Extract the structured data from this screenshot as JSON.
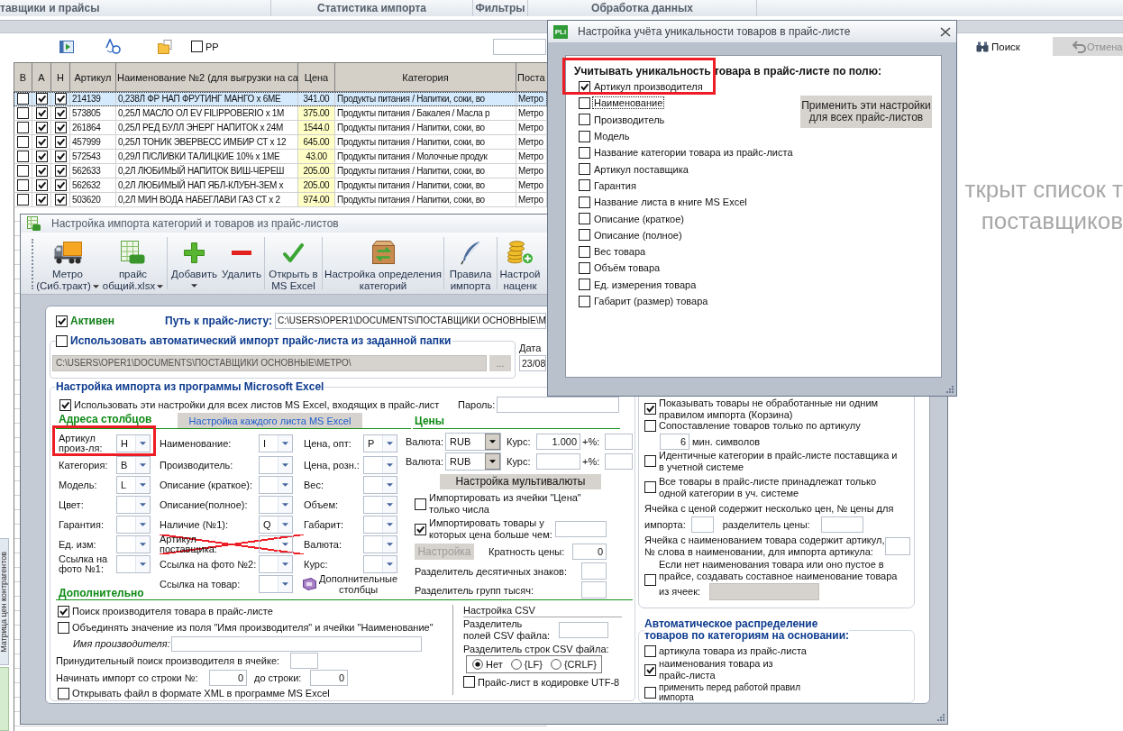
{
  "app_tabs": [
    {
      "label": "тавщики и прайсы"
    },
    {
      "label": "Статистика импорта"
    },
    {
      "label": "Фильтры"
    },
    {
      "label": "Обработка данных"
    }
  ],
  "side_tab": "Матрица цен контрагентов",
  "toolbar": {
    "pp": {
      "label": "PP",
      "checked": false
    },
    "search_button": "Поиск",
    "cancel_button": {
      "label": "Отмена",
      "disabled": true
    }
  },
  "table": {
    "columns": [
      "В",
      "А",
      "Н",
      "Артикул",
      "Наименование №2 (для выгрузки на са",
      "Цена",
      "Категория",
      "Поста"
    ],
    "rows": [
      {
        "selected": true,
        "checks": [
          false,
          true,
          true
        ],
        "article": "214139",
        "name": "0,238Л ФР НАП ФРУТИНГ МАНГО x 6МЕ",
        "price": "341.00",
        "category": "Продукты питания / Напитки, соки, во",
        "supplier": "Метро"
      },
      {
        "selected": false,
        "checks": [
          false,
          true,
          true
        ],
        "article": "573805",
        "name": "0,25Л МАСЛО ОЛ EV FILIPPOBERIO x 1М",
        "price": "375.00",
        "category": "Продукты питания / Бакалея / Масла р",
        "supplier": "Метро"
      },
      {
        "selected": false,
        "checks": [
          false,
          true,
          true
        ],
        "article": "261864",
        "name": "0,25Л РЕД БУЛЛ ЭНЕРГ НАПИТОК x 24М",
        "price": "1544.0",
        "category": "Продукты питания / Напитки, соки, во",
        "supplier": "Метро"
      },
      {
        "selected": false,
        "checks": [
          false,
          true,
          true
        ],
        "article": "457999",
        "name": "0,25Л ТОНИК ЭВЕРВЕСС ИМБИР СТ x 12",
        "price": "645.00",
        "category": "Продукты питания / Напитки, соки, во",
        "supplier": "Метро"
      },
      {
        "selected": false,
        "checks": [
          false,
          true,
          true
        ],
        "article": "572543",
        "name": "0,29Л П/СЛИВКИ ТАЛИЦКИЕ 10% x 1МЕ",
        "price": "43.00",
        "category": "Продукты питания / Молочные продук",
        "supplier": "Метро"
      },
      {
        "selected": false,
        "checks": [
          false,
          true,
          true
        ],
        "article": "562633",
        "name": "0,2Л ЛЮБИМЫЙ НАПИТОК ВИШ-ЧЕРЕШ",
        "price": "205.00",
        "category": "Продукты питания / Напитки, соки, во",
        "supplier": "Метро"
      },
      {
        "selected": false,
        "checks": [
          false,
          true,
          true
        ],
        "article": "562632",
        "name": "0,2Л ЛЮБИМЫЙ НАП ЯБЛ-КЛУБН-ЗЕМ x",
        "price": "205.00",
        "category": "Продукты питания / Напитки, соки, во",
        "supplier": "Метро"
      },
      {
        "selected": false,
        "checks": [
          false,
          true,
          true
        ],
        "article": "503620",
        "name": "0,2Л МИН ВОДА НАБЕГЛАВИ ГАЗ СТ x 2",
        "price": "974.00",
        "category": "Продукты питания / Напитки, соки, во",
        "supplier": "Метро"
      }
    ]
  },
  "empty_message": [
    "ткрыт список т",
    "поставщиков"
  ],
  "import_dialog": {
    "title": "Настройка импорта категорий и товаров из прайс-листов",
    "toolbar": [
      [
        {
          "kind": "truck",
          "label": "Метро\n(Сиб.тракт)",
          "dropdown": true,
          "caret_below": false
        },
        {
          "kind": "spreadsheet",
          "label": "прайс\nобщий.xlsx",
          "dropdown": true,
          "caret_below": false
        }
      ],
      [
        {
          "kind": "plus",
          "label": "Добавить",
          "dropdown": true,
          "caret_below": true
        },
        {
          "kind": "minus",
          "label": "Удалить",
          "dropdown": false
        }
      ],
      [
        {
          "kind": "check",
          "label": "Открыть в\nMS Excel",
          "dropdown": false
        }
      ],
      [
        {
          "kind": "box",
          "label": "Настройка определения\nкатегорий",
          "dropdown": false
        }
      ],
      [
        {
          "kind": "quill",
          "label": "Правила\nимпорта",
          "dropdown": false
        }
      ],
      [
        {
          "kind": "coins",
          "label": "Настрой\nнаценк",
          "dropdown": false
        }
      ]
    ],
    "form": {
      "active": {
        "label": "Активен",
        "checked": true
      },
      "path_label": "Путь к прайс-листу:",
      "path": "C:\\USERS\\OPER1\\DOCUMENTS\\ПОСТАВЩИКИ ОСНОВНЫЕ\\М",
      "auto_import": {
        "label": "Использовать автоматический импорт прайс-листа из заданной папки",
        "checked": false
      },
      "folder": {
        "value": "C:\\USERS\\OPER1\\DOCUMENTS\\ПОСТАВЩИКИ ОСНОВНЫЕ\\МЕТРО\\",
        "disabled": true
      },
      "browse_button": "...",
      "date_label": "Дата",
      "date": "23/08",
      "excel": {
        "title": "Настройка импорта из программы Microsoft Excel",
        "all_sheets": {
          "label": "Использовать эти настройки для всех листов MS Excel, входящих в прайс-лист",
          "checked": true
        },
        "password_label": "Пароль:",
        "sheets_button": "Настройка каждого листа MS Excel"
      },
      "columns_title": "Адреса столбцов",
      "column_groups": [
        [
          {
            "kind": "combo",
            "label": "Артикул\nпроиз-ля:",
            "value": "H",
            "crossed_out": false
          },
          {
            "kind": "combo",
            "label": "Категория:",
            "value": "B",
            "crossed_out": false
          },
          {
            "kind": "combo",
            "label": "Модель:",
            "value": "L",
            "crossed_out": false
          },
          {
            "kind": "combo",
            "label": "Цвет:",
            "crossed_out": false
          },
          {
            "kind": "combo",
            "label": "Гарантия:",
            "crossed_out": false
          },
          {
            "kind": "combo",
            "label": "Ед. изм:",
            "crossed_out": false
          },
          {
            "kind": "combo",
            "label": "Ссылка на\nфото №1:",
            "crossed_out": false
          }
        ],
        [
          {
            "kind": "combo",
            "label": "Наименование:",
            "value": "I",
            "crossed_out": false
          },
          {
            "kind": "combo",
            "label": "Производитель:",
            "crossed_out": false
          },
          {
            "kind": "combo",
            "label": "Описание (краткое):",
            "crossed_out": false
          },
          {
            "kind": "combo",
            "label": "Описание(полное):",
            "crossed_out": false
          },
          {
            "kind": "combo",
            "label": "Наличие (№1):",
            "value": "Q",
            "crossed_out": false
          },
          {
            "kind": "combo",
            "label": "Артикул\nпоставщика:",
            "crossed_out": true
          },
          {
            "kind": "combo",
            "label": "Ссылка на фото №2:",
            "crossed_out": false
          },
          {
            "kind": "combo",
            "label": "Ссылка на товар:",
            "crossed_out": false
          }
        ],
        [
          {
            "kind": "combo",
            "label": "Цена, опт:",
            "value": "P",
            "crossed_out": false
          },
          {
            "kind": "combo",
            "label": "Цена, розн.:",
            "crossed_out": false
          },
          {
            "kind": "combo",
            "label": "Вес:",
            "crossed_out": false
          },
          {
            "kind": "combo",
            "label": "Объем:",
            "crossed_out": false
          },
          {
            "kind": "combo",
            "label": "Габарит:",
            "crossed_out": false
          },
          {
            "kind": "combo",
            "label": "Валюта:",
            "crossed_out": false
          },
          {
            "kind": "combo",
            "label": "Курс:",
            "crossed_out": false
          },
          {
            "kind": "link",
            "label": "Дополнительные\nстолбцы"
          }
        ]
      ],
      "prices": {
        "title": "Цены",
        "currencies": [
          {
            "label": "Валюта:",
            "value": "RUB",
            "rate_label": "Курс:",
            "rate": "1.000",
            "percent_label": "+%:"
          },
          {
            "label": "Валюта:",
            "value": "RUB",
            "rate_label": "Курс:",
            "percent_label": "+%:"
          }
        ],
        "multicurrency_button": "Настройка мультивалюты",
        "numbers_only": {
          "label": "Импортировать из ячейки \"Цена\"\nтолько числа",
          "checked": false
        },
        "min_price": {
          "label": "Импортировать товары у\nкоторых цена больше чем:",
          "checked": true
        },
        "setup_button": {
          "label": "Настройка",
          "disabled": true
        },
        "rounding_label": "Кратность цены:",
        "rounding": "0",
        "decimal_label": "Разделитель десятичных знаков:",
        "thousands_label": "Разделитель групп тысяч:"
      },
      "additional": {
        "title": "Дополнительно",
        "find_maker": {
          "label": "Поиск производителя товара в прайс-листе",
          "checked": true
        },
        "merge": {
          "label": "Объединять значение из поля \"Имя производителя\" и ячейки \"Наименование\"",
          "checked": false
        },
        "maker_name_label": "Имя производителя:",
        "forced_label": "Принудительный поиск производителя в ячейке:",
        "start_label": "Начинать импорт со строки №:",
        "start": "0",
        "end_label": "до строки:",
        "end": "0",
        "xml": {
          "label": "Открывать файл в формате XML в программе MS Excel",
          "checked": false
        }
      },
      "csv": {
        "title": "Настройка CSV",
        "field_sep_label": "Разделитель\nполей CSV файла:",
        "row_sep_label": "Разделитель строк CSV файла:",
        "row_sep": [
          {
            "label": "Нет",
            "selected": true
          },
          {
            "label": "{LF}",
            "selected": false
          },
          {
            "label": "{CRLF}",
            "selected": false
          }
        ],
        "utf8": {
          "label": "Прайс-лист в кодировке UTF-8",
          "checked": false
        }
      },
      "options": [
        {
          "kind": "checkbox",
          "label": "Показывать товары не обработанные ни одним\nправилом импорта (Корзина)",
          "checked": true
        },
        {
          "kind": "article_match",
          "label": "Сопоставление товаров только по артикулу",
          "checked": false,
          "min_length": "6",
          "min_length_label": "мин. символов"
        },
        {
          "kind": "checkbox",
          "label": "Идентичные категории в прайс-листе поставщика и\nв учетной системе",
          "checked": false
        },
        {
          "kind": "checkbox",
          "label": "Все товары в прайс-листе принадлежат только\nодной категории в уч. системе",
          "checked": false
        },
        {
          "kind": "price_index",
          "label": "Ячейка с ценой содержит несколько цен, № цены для",
          "number_label": "импорта:",
          "separator_label": "разделитель цены:"
        },
        {
          "kind": "article_word",
          "label": "Ячейка с наименованием товара содержит артикул,\n№ слова в наименовании, для импорта артикула:"
        },
        {
          "kind": "compose",
          "label": "Если нет наименования товара или оно пустое в\nпрайсе, создавать составное наименование товара",
          "field_label": "из ячеек:",
          "checked": false,
          "field_disabled": true
        }
      ],
      "auto_distribution": {
        "title": "Автоматическое распределение\nтоваров по категориям на основании:",
        "items": [
          {
            "kind": "option",
            "label": "артикула товара из прайс-листа",
            "checked": false
          },
          {
            "kind": "option",
            "label": "наименования товара из\nпрайс-листа",
            "checked": true
          },
          {
            "kind": "note",
            "label": "применить перед работой правил\nимпорта",
            "checked": false
          }
        ]
      }
    }
  },
  "uniqueness_dialog": {
    "badge": "PLi",
    "title": "Настройка учёта уникальности товаров в прайс-листе",
    "heading": "Учитывать уникальность товара в прайс-листе по полю:",
    "fields": [
      {
        "label": "Артикул производителя",
        "checked": true,
        "focused": false
      },
      {
        "label": "Наименование",
        "checked": false,
        "focused": true
      },
      {
        "label": "Производитель",
        "checked": false,
        "focused": false
      },
      {
        "label": "Модель",
        "checked": false,
        "focused": false
      },
      {
        "label": "Название категории товара из прайс-листа",
        "checked": false,
        "focused": false
      },
      {
        "label": "Артикул поставщика",
        "checked": false,
        "focused": false
      },
      {
        "label": "Гарантия",
        "checked": false,
        "focused": false
      },
      {
        "label": "Название листа в книге MS Excel",
        "checked": false,
        "focused": false
      },
      {
        "label": "Описание (краткое)",
        "checked": false,
        "focused": false
      },
      {
        "label": "Описание (полное)",
        "checked": false,
        "focused": false
      },
      {
        "label": "Вес товара",
        "checked": false,
        "focused": false
      },
      {
        "label": "Объём товара",
        "checked": false,
        "focused": false
      },
      {
        "label": "Ед. измерения товара",
        "checked": false,
        "focused": false
      },
      {
        "label": "Габарит (размер) товара",
        "checked": false,
        "focused": false
      }
    ],
    "apply_button": "Применить эти настройки\nдля всех прайс-листов"
  }
}
